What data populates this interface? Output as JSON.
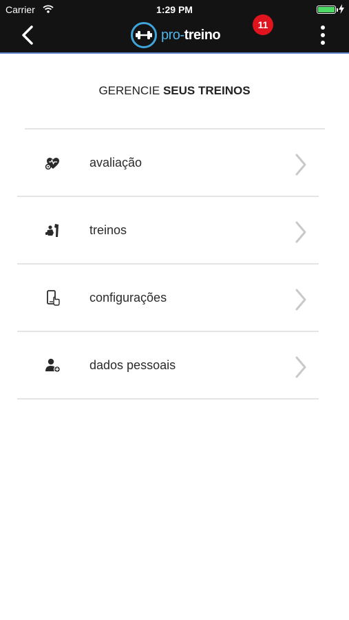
{
  "status_bar": {
    "carrier": "Carrier",
    "time": "1:29 PM",
    "battery_level": 1.0,
    "battery_color": "#4cd964"
  },
  "header": {
    "back_icon": "chevron-left-icon",
    "logo_prefix": "pro-",
    "logo_name": "treino",
    "notification_count": "11",
    "menu_icon": "more-vertical-icon",
    "colors": {
      "background": "#131313",
      "accent_line": "#5b82c4",
      "logo_blue": "#4fb5e8",
      "badge": "#e0141e"
    }
  },
  "page": {
    "heading_prefix": "GERENCIE ",
    "heading_bold": "SEUS TREINOS"
  },
  "menu": {
    "items": [
      {
        "label": "avaliação",
        "icon": "heart-gear-icon"
      },
      {
        "label": "treinos",
        "icon": "gym-equipment-icon"
      },
      {
        "label": "configurações",
        "icon": "phone-touch-icon"
      },
      {
        "label": "dados pessoais",
        "icon": "user-add-icon"
      }
    ],
    "chevron_icon": "chevron-right-icon"
  }
}
